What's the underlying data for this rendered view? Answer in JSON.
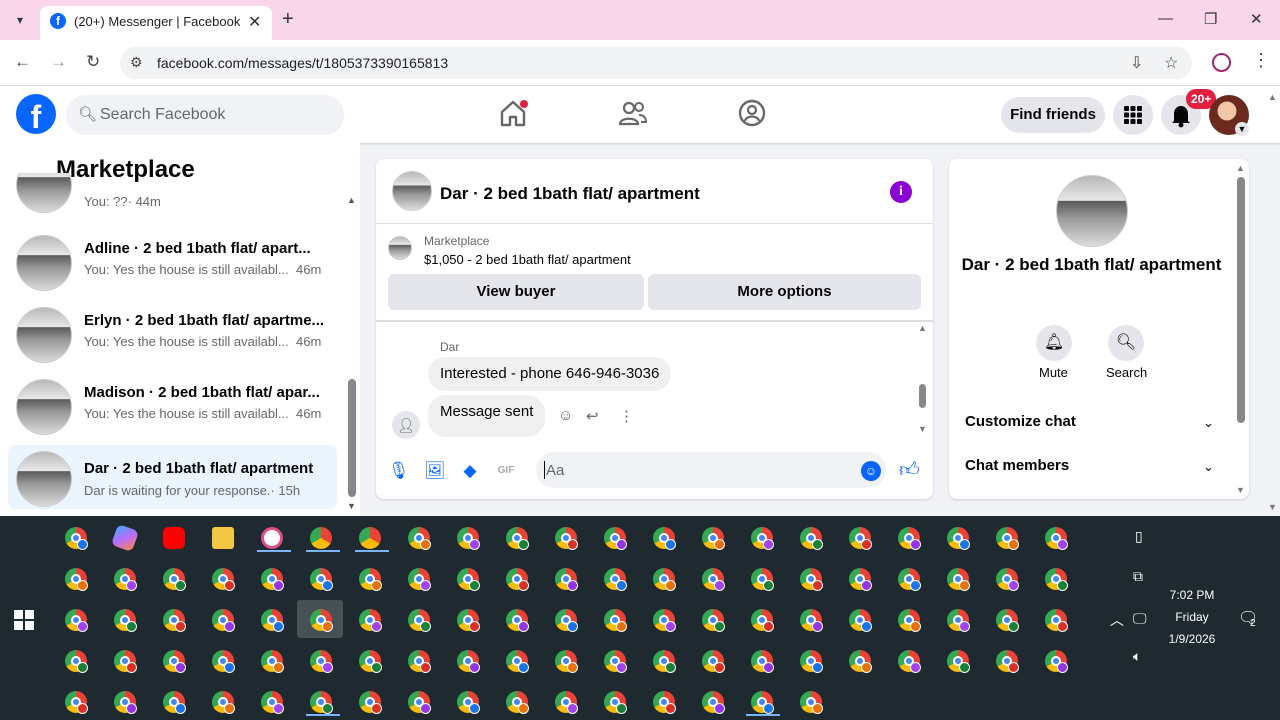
{
  "browser": {
    "tab_title": "(20+) Messenger | Facebook",
    "url": "facebook.com/messages/t/1805373390165813"
  },
  "fb": {
    "search_placeholder": "Search Facebook",
    "find_friends": "Find friends",
    "notif_count": "20+"
  },
  "sidebar": {
    "title": "Marketplace",
    "conversations": [
      {
        "name": "",
        "snippet": "You: ??",
        "time": "· 44m"
      },
      {
        "name": "Adline · 2 bed 1bath flat/ apart...",
        "snippet": "You: Yes the house is still availabl...",
        "time": "46m"
      },
      {
        "name": "Erlyn · 2 bed 1bath flat/ apartme...",
        "snippet": "You: Yes the house is still availabl...",
        "time": "46m"
      },
      {
        "name": "Madison · 2 bed 1bath flat/ apar...",
        "snippet": "You: Yes the house is still availabl...",
        "time": "46m"
      },
      {
        "name": "Dar · 2 bed 1bath flat/ apartment",
        "snippet": "Dar is waiting for your response.",
        "time": "· 15h"
      }
    ]
  },
  "chat": {
    "title": "Dar · 2 bed 1bath flat/ apartment",
    "marketplace_label": "Marketplace",
    "listing": "$1,050 - 2 bed 1bath flat/ apartment",
    "view_buyer": "View buyer",
    "more_options": "More options",
    "sender": "Dar",
    "messages": [
      "Interested - phone 646-946-3036",
      "Message sent"
    ],
    "composer_placeholder": "Aa"
  },
  "details": {
    "title": "Dar · 2 bed 1bath flat/ apartment",
    "mute": "Mute",
    "search": "Search",
    "customize": "Customize chat",
    "members": "Chat members"
  },
  "taskbar": {
    "time": "7:02 PM",
    "day": "Friday",
    "date": "1/9/2026",
    "notif": "2"
  }
}
